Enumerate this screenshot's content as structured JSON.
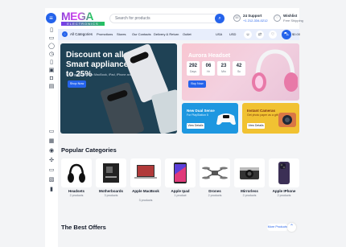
{
  "header": {
    "logo_main": "MEGA",
    "logo_sub": "ELECTRONICS",
    "search_placeholder": "Search for products",
    "support_title": "24 Support",
    "support_phone": "+1 212-334-0212",
    "wishlist_title": "Wishlist",
    "wishlist_sub": "Free Shipping"
  },
  "nav": {
    "all_categories": "All Categories",
    "links": [
      "Promotions",
      "Stores",
      "Our Contacts",
      "Delivery & Return",
      "Outlet"
    ],
    "currency": "USA",
    "language": "USD",
    "cart_label": "$0.00"
  },
  "hero": {
    "title": "Discount on all Smart appliances up to 25%",
    "subtitle": "Shop great deals on MacBook, iPad, iPhone and more.",
    "button": "Shop Now"
  },
  "aurora": {
    "title": "Aurora Headset",
    "timer": [
      {
        "value": "292",
        "unit": "Days"
      },
      {
        "value": "06",
        "unit": "Hr"
      },
      {
        "value": "23",
        "unit": "Min"
      },
      {
        "value": "42",
        "unit": "Sc"
      }
    ],
    "button": "Buy Now"
  },
  "dual": {
    "title": "New Dual Sense",
    "subtitle": "For PlayStation 5",
    "button": "View Details"
  },
  "instant": {
    "title": "Instant Cameras",
    "subtitle": "Get photo paper as a gift",
    "button": "View Details"
  },
  "categories": {
    "title": "Popular Categories",
    "items": [
      {
        "name": "Headsets",
        "count": "2 products"
      },
      {
        "name": "Motherboards",
        "count": "3 products"
      },
      {
        "name": "Apple MacBook",
        "count": "3 products"
      },
      {
        "name": "Apple Ipad",
        "count": "1 product"
      },
      {
        "name": "Drones",
        "count": "2 products"
      },
      {
        "name": "Mirrorless",
        "count": "2 products"
      },
      {
        "name": "Apple IPhone",
        "count": "2 products"
      }
    ]
  },
  "offers": {
    "title": "The Best Offers",
    "more": "More Products"
  },
  "colors": {
    "accent": "#2563eb",
    "hero_bg": "#1f4255",
    "dual_bg": "#1d97e0",
    "instant_bg": "#f1c232"
  }
}
